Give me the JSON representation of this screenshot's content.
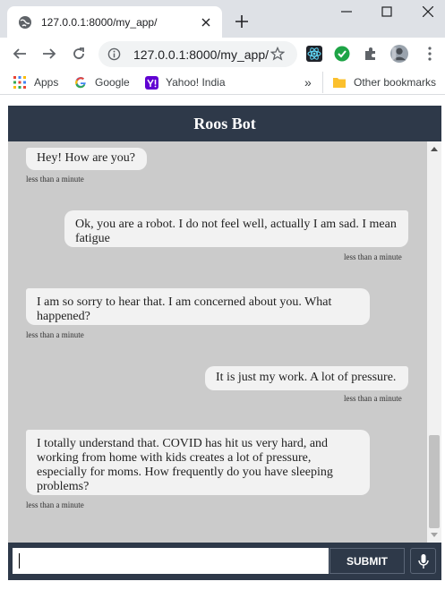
{
  "browser": {
    "tab_title": "127.0.0.1:8000/my_app/",
    "url": "127.0.0.1:8000/my_app/",
    "bookmarks": [
      {
        "label": "Apps",
        "icon": "apps-grid-icon"
      },
      {
        "label": "Google",
        "icon": "google-icon"
      },
      {
        "label": "Yahoo! India",
        "icon": "yahoo-icon"
      }
    ],
    "other_bookmarks": "Other bookmarks",
    "overflow": "»"
  },
  "chat": {
    "title": "Roos Bot",
    "messages": [
      {
        "sender": "bot",
        "text": "Hey! How are you?",
        "time": "less than a minute"
      },
      {
        "sender": "user",
        "text": "Ok, you are a robot. I do not feel well, actually I am sad. I mean fatigue",
        "time": "less than a minute"
      },
      {
        "sender": "bot",
        "text": "I am so sorry to hear that. I am concerned about you. What happened?",
        "time": "less than a minute"
      },
      {
        "sender": "user",
        "text": "It is just my work. A lot of pressure.",
        "time": "less than a minute"
      },
      {
        "sender": "bot",
        "text": "I totally understand that. COVID has hit us very hard, and working from home with kids creates a lot of pressure, especially for moms. How frequently do you have sleeping problems?",
        "time": "less than a minute"
      }
    ],
    "input_value": "",
    "submit_label": "SUBMIT"
  },
  "colors": {
    "header_bg": "#2e3949",
    "chat_bg": "#cbcbcb",
    "bubble_bg": "#f2f2f2"
  }
}
